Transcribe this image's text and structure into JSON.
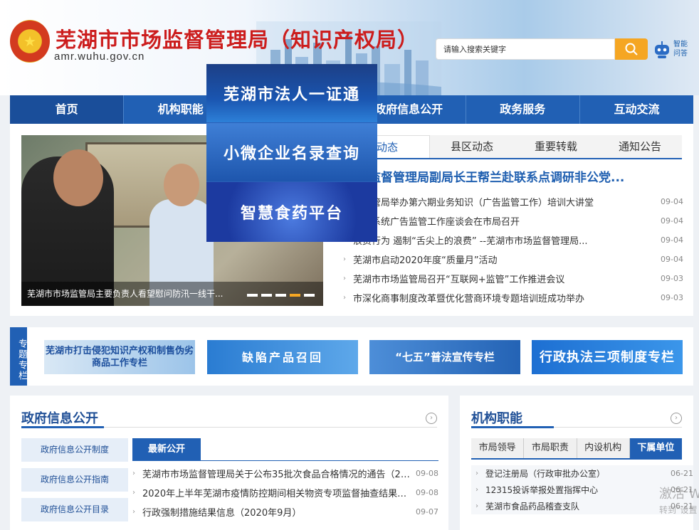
{
  "header": {
    "title": "芜湖市市场监督管理局（知识产权局）",
    "domain": "amr.wuhu.gov.cn",
    "search_placeholder": "请输入搜索关键字",
    "assistant_label": "智能问答"
  },
  "nav": [
    "首页",
    "机构职能",
    "",
    "政府信息公开",
    "政务服务",
    "互动交流"
  ],
  "slider": {
    "caption": "芜湖市市场监管局主要负责人看望慰问防汛一线干...",
    "dots": 5,
    "active_dot": 4
  },
  "float_panel": [
    "芜湖市法人一证通",
    "小微企业名录查询",
    "智慧食药平台"
  ],
  "news": {
    "tabs": [
      "动态",
      "县区动态",
      "重要转载",
      "通知公告"
    ],
    "headline": "市场监督管理局副局长王帮兰赴联系点调研非公党...",
    "items": [
      {
        "title": "场监管局举办第六期业务知识（广告监管工作）培训大讲堂",
        "date": "09-04"
      },
      {
        "title": "监管系统广告监管工作座谈会在市局召开",
        "date": "09-04"
      },
      {
        "title": "浪费行为 遏制“舌尖上的浪费” --芜湖市市场监督管理局...",
        "date": "09-04"
      },
      {
        "title": "芜湖市启动2020年度“质量月”活动",
        "date": "09-04"
      },
      {
        "title": "芜湖市市场监管局召开“互联网+监管”工作推进会议",
        "date": "09-03"
      },
      {
        "title": "市深化商事制度改革暨优化营商环境专题培训班成功举办",
        "date": "09-03"
      }
    ]
  },
  "topics": {
    "label": "专题专栏",
    "banners": [
      "芜湖市打击侵犯知识产权和制售伪劣商品工作专栏",
      "缺陷产品召回",
      "“七五”普法宣传专栏",
      "行政执法三项制度专栏"
    ]
  },
  "gov_info": {
    "title": "政府信息公开",
    "buttons": [
      "政府信息公开制度",
      "政府信息公开指南",
      "政府信息公开目录"
    ],
    "tab": "最新公开",
    "items": [
      {
        "title": "芜湖市市场监督管理局关于公布35批次食品合格情况的通告（20...",
        "date": "09-08"
      },
      {
        "title": "2020年上半年芜湖市疫情防控期间相关物资专项监督抽查结果通报",
        "date": "09-08"
      },
      {
        "title": "行政强制措施结果信息（2020年9月）",
        "date": "09-07"
      }
    ]
  },
  "org": {
    "title": "机构职能",
    "tabs": [
      "市局领导",
      "市局职责",
      "内设机构",
      "下属单位"
    ],
    "items": [
      {
        "title": "登记注册局（行政审批办公室）",
        "date": "06-21"
      },
      {
        "title": "12315投诉举报处置指挥中心",
        "date": "06-21"
      },
      {
        "title": "芜湖市食品药品稽查支队",
        "date": "06-21"
      }
    ]
  },
  "watermark": {
    "line1": "激活 W",
    "line2": "转到\"设置"
  }
}
